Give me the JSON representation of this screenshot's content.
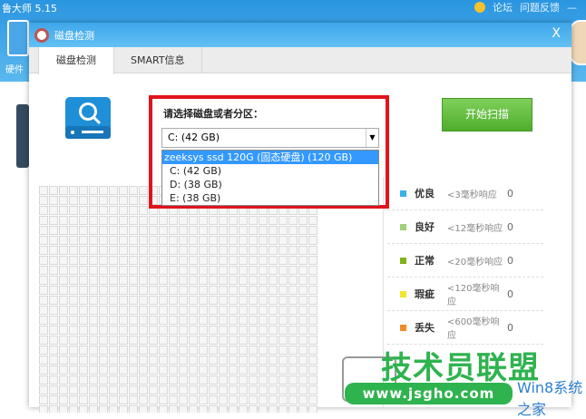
{
  "app": {
    "title": "鲁大师 5.15",
    "links": [
      "论坛",
      "问题反馈"
    ],
    "side_label": "硬件"
  },
  "dialog": {
    "title": "磁盘检测",
    "close": "X",
    "tabs": [
      "磁盘检测",
      "SMART信息"
    ]
  },
  "selector": {
    "label": "请选择磁盘或者分区：",
    "value": "C:  (42 GB)",
    "options": [
      "zeeksys ssd 120G (固态硬盘)  (120 GB)",
      "C:  (42 GB)",
      "D:  (38 GB)",
      "E:  (38 GB)"
    ]
  },
  "scan_button": "开始扫描",
  "legend": [
    {
      "name": "优良",
      "desc": "<3毫秒响应",
      "count": "0",
      "color": "#3ab0e8"
    },
    {
      "name": "良好",
      "desc": "<12毫秒响应",
      "count": "0",
      "color": "#9fd07a"
    },
    {
      "name": "正常",
      "desc": "<20毫秒响应",
      "count": "0",
      "color": "#7fb41c"
    },
    {
      "name": "瑕疵",
      "desc": "<120毫秒响应",
      "count": "0",
      "color": "#f1e62c"
    },
    {
      "name": "丢失",
      "desc": "<600毫秒响应",
      "count": "0",
      "color": "#f18a2a"
    }
  ],
  "watermark": {
    "main": "技术员联盟",
    "url": "www.jsgho.com",
    "sub": "Win8系统之家"
  }
}
